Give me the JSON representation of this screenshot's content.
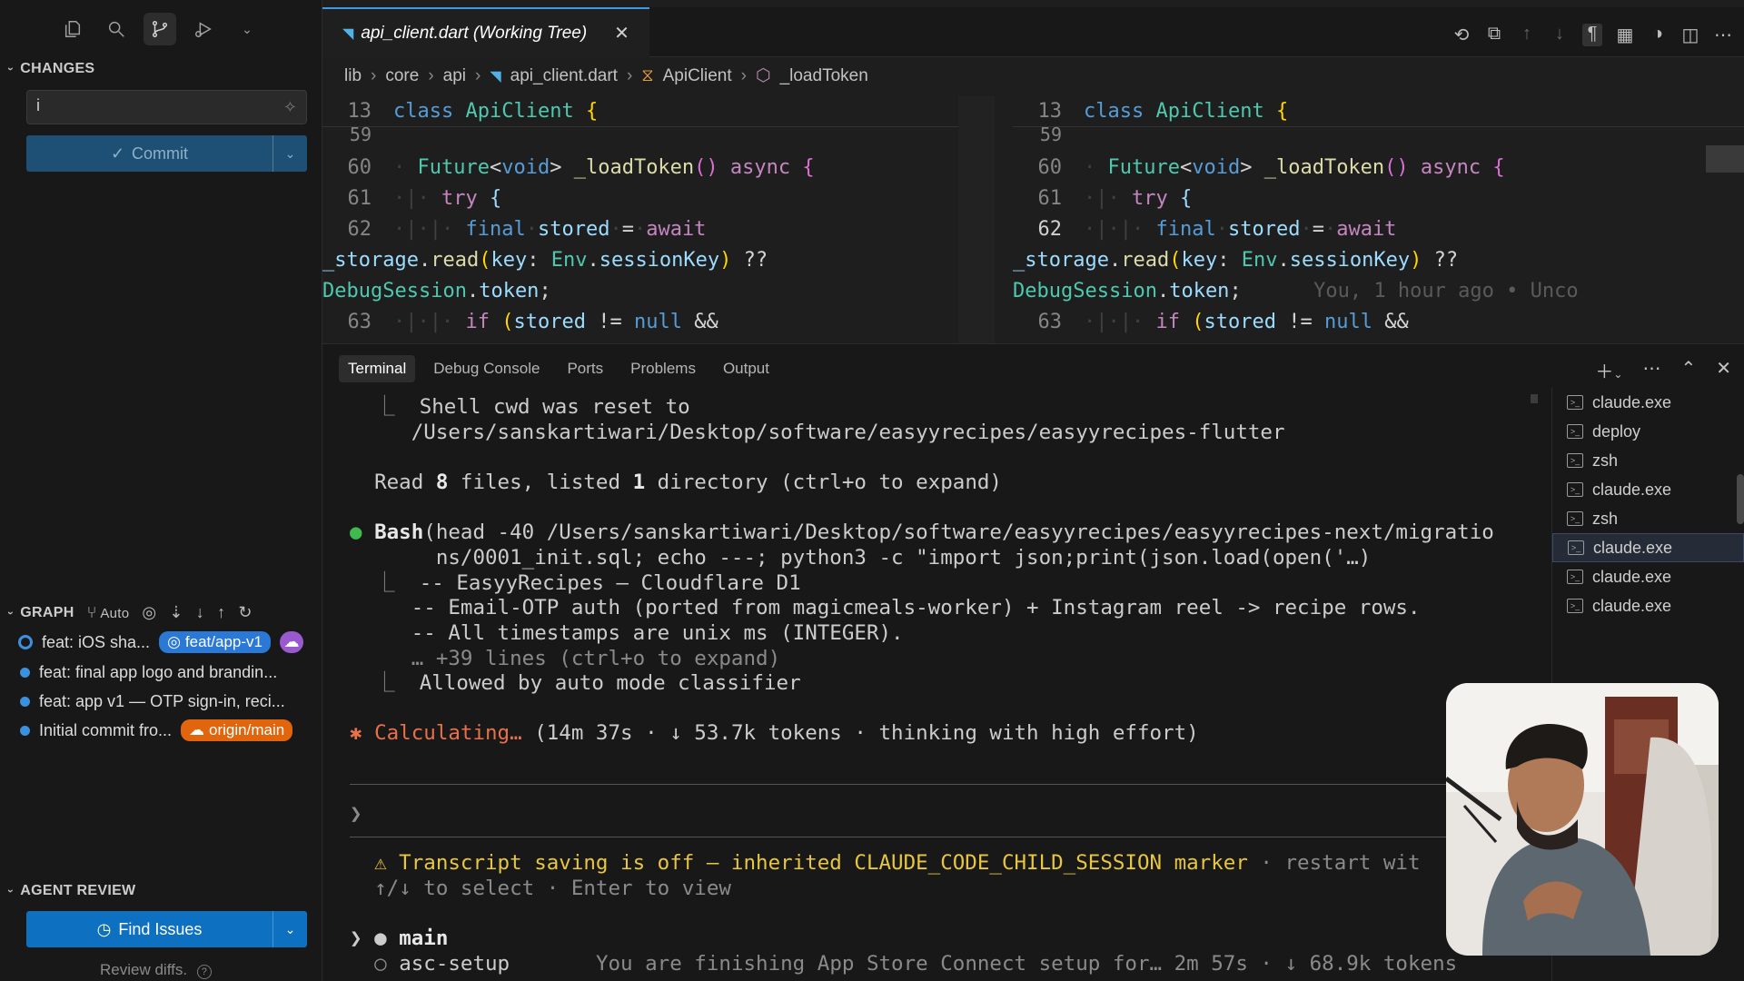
{
  "sidebar": {
    "changes_title": "CHANGES",
    "commit_message": "i",
    "commit_label": "Commit",
    "graph_title": "GRAPH",
    "graph_mode": "Auto",
    "commits": [
      {
        "message": "feat: iOS sha...",
        "branch": "feat/app-v1"
      },
      {
        "message": "feat: final app logo and brandin..."
      },
      {
        "message": "feat: app v1 — OTP sign-in, reci..."
      },
      {
        "message": "Initial commit fro...",
        "branch": "origin/main"
      }
    ],
    "agent_title": "AGENT REVIEW",
    "find_label": "Find Issues",
    "review_text": "Review diffs."
  },
  "editor": {
    "tab_title": "api_client.dart (Working Tree)",
    "breadcrumb": [
      "lib",
      "core",
      "api",
      "api_client.dart",
      "ApiClient",
      "_loadToken"
    ],
    "blame": "You, 1 hour ago • Unco",
    "line_numbers": {
      "sticky": "13",
      "l59": "59",
      "l60": "60",
      "l61": "61",
      "l62": "62",
      "l63": "63"
    }
  },
  "panel": {
    "tabs": [
      "Terminal",
      "Debug Console",
      "Ports",
      "Problems",
      "Output"
    ],
    "lines": {
      "cwd1": "Shell cwd was reset to",
      "cwd2": "/Users/sanskartiwari/Desktop/software/easyyrecipes/easyyrecipes-flutter",
      "read_pre": "Read ",
      "read_n1": "8",
      "read_mid": " files, listed ",
      "read_n2": "1",
      "read_post": " directory (ctrl+o to expand)",
      "bash_name": "Bash",
      "bash_cmd1": "(head -40 /Users/sanskartiwari/Desktop/software/easyyrecipes/easyyrecipes-next/migratio",
      "bash_cmd2": "ns/0001_init.sql; echo ---; python3 -c \"import json;print(json.load(open('…)",
      "out1": "-- EasyyRecipes — Cloudflare D1",
      "out2": "-- Email-OTP auth (ported from magicmeals-worker) + Instagram reel -> recipe rows.",
      "out3": "-- All timestamps are unix ms (INTEGER).",
      "out4": "… +39 lines (ctrl+o to expand)",
      "allowed": "Allowed by auto mode classifier",
      "calc_label": "Calculating…",
      "calc_stats": " (14m 37s · ↓ 53.7k tokens · thinking with high effort)",
      "warn": "⚠ Transcript saving is off — inherited CLAUDE_CODE_CHILD_SESSION marker",
      "warn_tail": " · restart wit",
      "select_hint": "↑/↓ to select · Enter to view",
      "main": "main",
      "asc_name": "asc-setup",
      "asc_desc": "You are finishing App Store Connect setup for… 2m 57s · ↓ 68.9k tokens"
    },
    "terminals": [
      "claude.exe",
      "deploy",
      "zsh",
      "claude.exe",
      "zsh",
      "claude.exe",
      "claude.exe",
      "claude.exe"
    ]
  },
  "colors": {
    "accent": "#0e639c",
    "branch_local": "#2a79d6",
    "branch_remote": "#e0650c",
    "status_green": "#3fb950"
  }
}
